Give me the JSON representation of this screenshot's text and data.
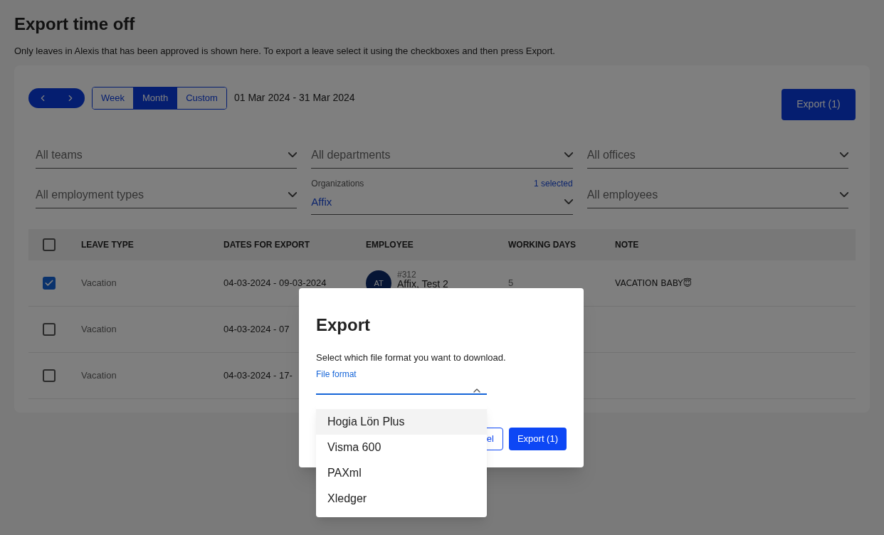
{
  "page": {
    "title": "Export time off",
    "description": "Only leaves in Alexis that has been approved is shown here. To export a leave select it using the checkboxes and then press Export."
  },
  "toolbar": {
    "ranges": [
      {
        "label": "Week",
        "selected": false
      },
      {
        "label": "Month",
        "selected": true
      },
      {
        "label": "Custom",
        "selected": false
      }
    ],
    "date_range": "01 Mar 2024 - 31 Mar 2024",
    "export_button": "Export (1)"
  },
  "filters": [
    {
      "placeholder": "All teams"
    },
    {
      "placeholder": "All departments"
    },
    {
      "placeholder": "All offices"
    },
    {
      "placeholder": "All employment types"
    },
    {
      "label": "Organizations",
      "count": "1 selected",
      "value": "Affix"
    },
    {
      "placeholder": "All employees"
    }
  ],
  "table": {
    "all_checked": false,
    "columns": [
      "LEAVE TYPE",
      "DATES FOR EXPORT",
      "EMPLOYEE",
      "WORKING DAYS",
      "NOTE"
    ],
    "rows": [
      {
        "checked": true,
        "leave_type": "Vacation",
        "dates": "04-03-2024 - 09-03-2024",
        "employee": {
          "initials": "AT",
          "number": "#312",
          "name": "Affix, Test 2"
        },
        "working_days": "5",
        "note": "VACATION BABY😇"
      },
      {
        "checked": false,
        "leave_type": "Vacation",
        "dates": "04-03-2024 - 07"
      },
      {
        "checked": false,
        "leave_type": "Vacation",
        "dates": "04-03-2024 - 17-"
      }
    ]
  },
  "dialog": {
    "title": "Export",
    "text": "Select which file format you want to download.",
    "field": {
      "label": "File format",
      "expanded": true
    },
    "options": [
      {
        "label": "Hogia Lön Plus",
        "selected": true
      },
      {
        "label": "Visma 600",
        "selected": false
      },
      {
        "label": "PAXml",
        "selected": false
      },
      {
        "label": "Xledger",
        "selected": false
      }
    ],
    "buttons": [
      {
        "kind": "secondary",
        "label": "el"
      },
      {
        "kind": "primary",
        "label": "Export (1)"
      }
    ]
  }
}
